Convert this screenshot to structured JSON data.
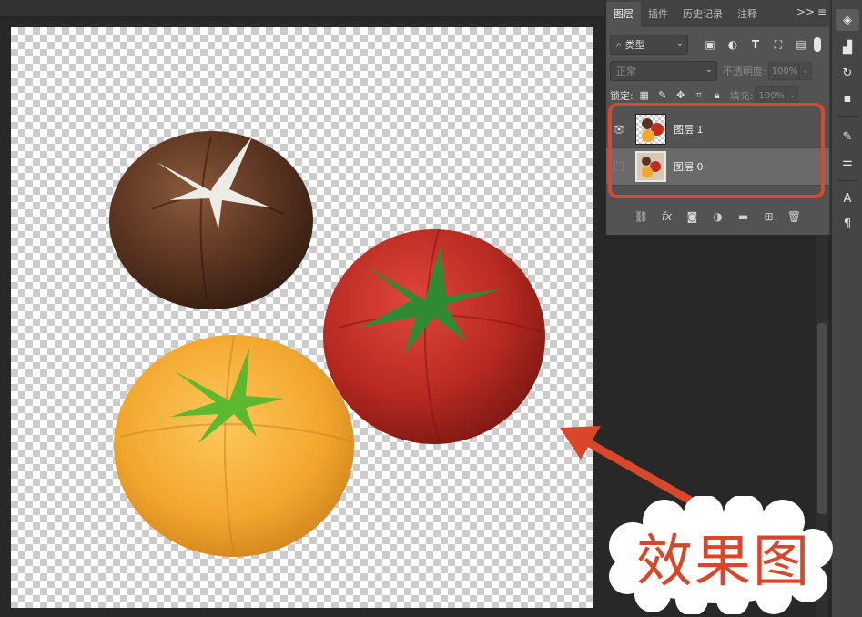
{
  "panel": {
    "tabs": [
      {
        "label": "图层",
        "active": true
      },
      {
        "label": "插件",
        "active": false
      },
      {
        "label": "历史记录",
        "active": false
      },
      {
        "label": "注释",
        "active": false
      }
    ],
    "more_label": ">>",
    "menu_icon": "menu-icon",
    "filter": {
      "label": "类型",
      "icon": "search-icon"
    },
    "filter_icons": [
      "image-filter-icon",
      "adjustment-filter-icon",
      "type-filter-icon",
      "shape-filter-icon",
      "smart-object-filter-icon"
    ],
    "blend_mode": "正常",
    "opacity_label": "不透明度:",
    "opacity_value": "100%",
    "lock_label": "锁定:",
    "fill_label": "填充:",
    "fill_value": "100%",
    "layers": [
      {
        "name": "图层 1",
        "visible": true,
        "selected": false
      },
      {
        "name": "图层 0",
        "visible": false,
        "selected": true
      }
    ],
    "bottom_icons": [
      "link-icon",
      "fx-icon",
      "mask-icon",
      "adjustment-icon",
      "folder-icon",
      "new-layer-icon",
      "trash-icon"
    ],
    "fx_label": "fx"
  },
  "toolstrip": [
    "layers-icon",
    "plugin-icon",
    "history-icon",
    "comment-icon",
    "brush-icon",
    "adjust-icon",
    "character-icon",
    "paragraph-icon"
  ],
  "annotation": {
    "caption": "效果图",
    "accent": "#d9472b"
  }
}
